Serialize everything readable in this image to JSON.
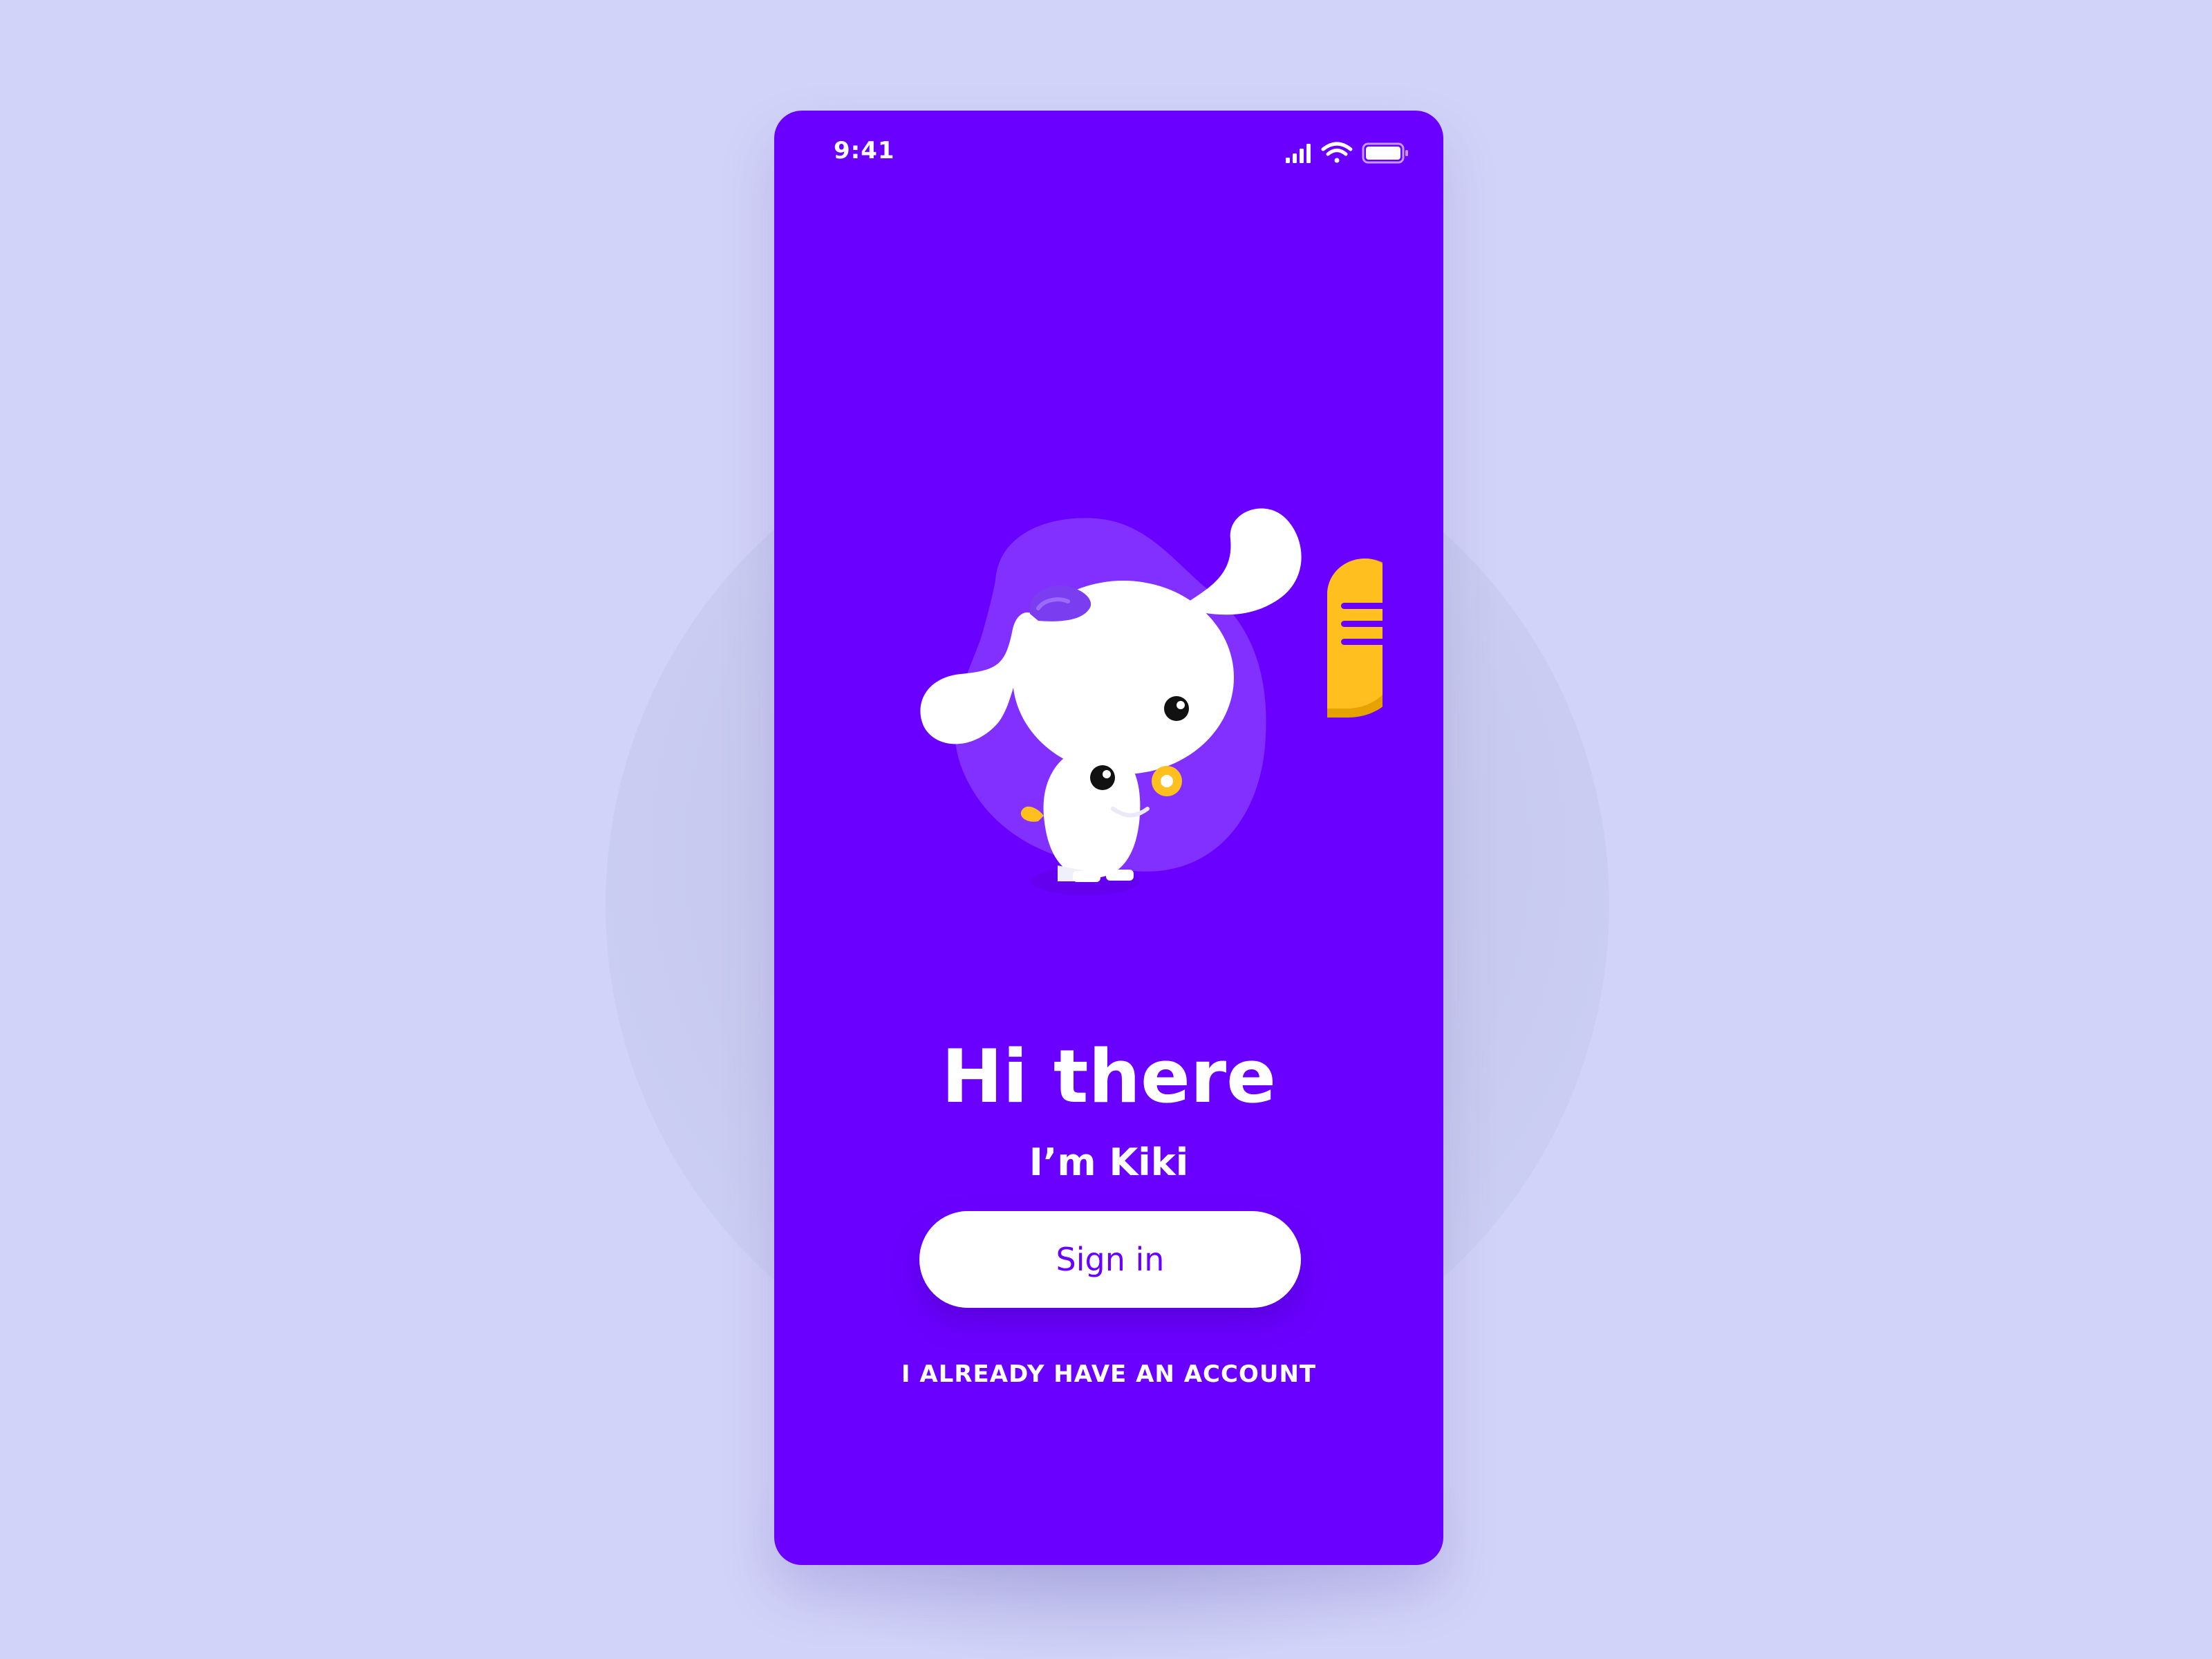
{
  "status_bar": {
    "time": "9:41"
  },
  "icons": {
    "signal": "cellular-signal-icon",
    "wifi": "wifi-icon",
    "battery": "battery-icon"
  },
  "illustration": {
    "name": "kiki-dog-mascot",
    "accent_color": "#ffbf1f"
  },
  "welcome": {
    "title": "Hi there",
    "subtitle": "I’m Kiki"
  },
  "actions": {
    "sign_in_label": "Sign in",
    "existing_account_label": "I ALREADY HAVE AN ACCOUNT"
  },
  "colors": {
    "background": "#d1d3f8",
    "primary": "#6a00ff",
    "blob": "#8130ff",
    "button": "#ffffff"
  }
}
